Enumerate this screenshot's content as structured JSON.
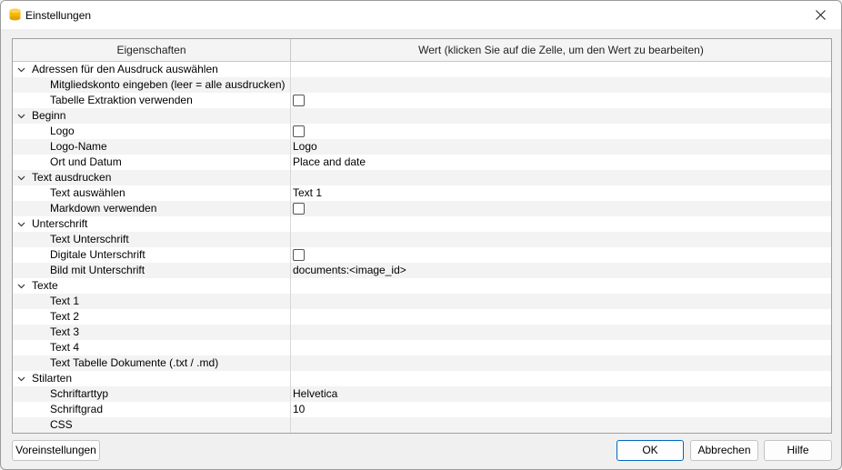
{
  "window": {
    "title": "Einstellungen"
  },
  "grid": {
    "headers": [
      "Eigenschaften",
      "Wert (klicken Sie auf die Zelle, um den Wert zu bearbeiten)"
    ],
    "rows": [
      {
        "label": "Adressen für den Ausdruck auswählen",
        "group": true
      },
      {
        "label": "Mitgliedskonto eingeben (leer = alle ausdrucken)"
      },
      {
        "label": "Tabelle Extraktion verwenden",
        "checkbox": true
      },
      {
        "label": "Beginn",
        "group": true
      },
      {
        "label": "Logo",
        "checkbox": true
      },
      {
        "label": "Logo-Name",
        "value": "Logo"
      },
      {
        "label": "Ort und Datum",
        "value": "Place and date"
      },
      {
        "label": "Text ausdrucken",
        "group": true
      },
      {
        "label": "Text auswählen",
        "value": "Text 1"
      },
      {
        "label": "Markdown verwenden",
        "checkbox": true
      },
      {
        "label": "Unterschrift",
        "group": true
      },
      {
        "label": "Text Unterschrift"
      },
      {
        "label": "Digitale Unterschrift",
        "checkbox": true
      },
      {
        "label": "Bild mit Unterschrift",
        "value": "documents:<image_id>"
      },
      {
        "label": "Texte",
        "group": true
      },
      {
        "label": "Text 1"
      },
      {
        "label": "Text 2"
      },
      {
        "label": "Text 3"
      },
      {
        "label": "Text 4"
      },
      {
        "label": "Text Tabelle Dokumente (.txt / .md)"
      },
      {
        "label": "Stilarten",
        "group": true
      },
      {
        "label": "Schriftarttyp",
        "value": "Helvetica"
      },
      {
        "label": "Schriftgrad",
        "value": "10"
      },
      {
        "label": "CSS"
      }
    ]
  },
  "buttons": {
    "defaults": "Voreinstellungen",
    "ok": "OK",
    "cancel": "Abbrechen",
    "help": "Hilfe"
  },
  "colors": {
    "accent": "#0067c0",
    "app_icon": "#f5b800"
  }
}
